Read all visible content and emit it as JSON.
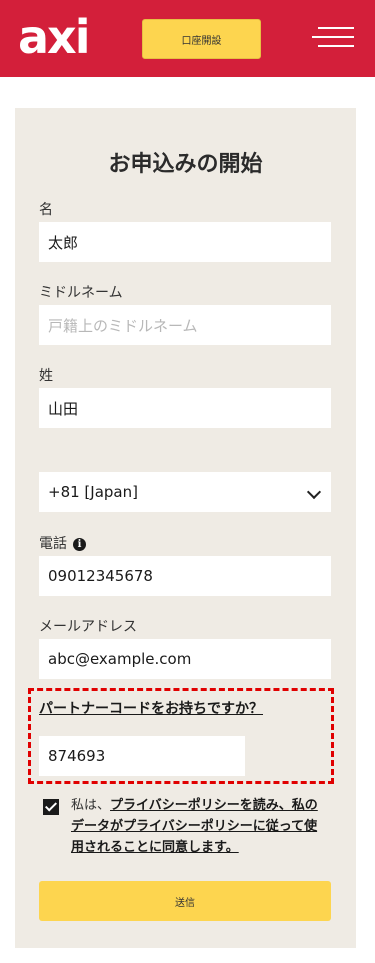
{
  "header": {
    "logo_text": "axi",
    "open_account_label": "口座開設",
    "brand_color": "#d31f3a",
    "button_color": "#fdd54f"
  },
  "form": {
    "title": "お申込みの開始",
    "first_name": {
      "label": "名",
      "value": "太郎"
    },
    "middle_name": {
      "label": "ミドルネーム",
      "placeholder": "戸籍上のミドルネーム"
    },
    "last_name": {
      "label": "姓",
      "value": "山田"
    },
    "country_code": {
      "value": "+81 [Japan]"
    },
    "phone": {
      "label": "電話",
      "value": "09012345678",
      "info_icon": "i"
    },
    "email": {
      "label": "メールアドレス",
      "value": "abc@example.com"
    },
    "partner": {
      "link_label": "パートナーコードをお持ちですか？",
      "value": "874693"
    },
    "consent": {
      "checked": true,
      "prefix": "私は、",
      "link": "プライバシーポリシーを読み、私のデータがプライバシーポリシーに従って使用されることに同意します。"
    },
    "submit_label": "送信"
  }
}
